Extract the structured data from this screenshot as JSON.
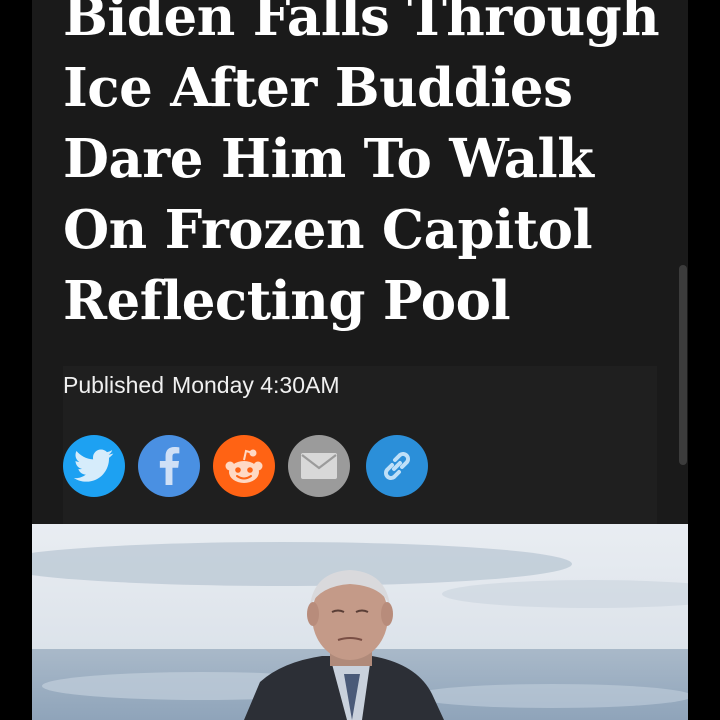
{
  "article": {
    "headline_lines": [
      "Biden Falls Through",
      "Ice After Buddies",
      "Dare Him To Walk",
      "On Frozen Capitol",
      "Reflecting Pool"
    ],
    "published_label": "Published",
    "published_time": "Monday 4:30AM"
  },
  "share_buttons": [
    {
      "name": "twitter",
      "icon": "twitter-bird-icon",
      "color": "#1da1f2"
    },
    {
      "name": "facebook",
      "icon": "facebook-f-icon",
      "color": "#4a90e2"
    },
    {
      "name": "reddit",
      "icon": "reddit-alien-icon",
      "color": "#ff6314"
    },
    {
      "name": "email",
      "icon": "envelope-icon",
      "color": "#9b9b9b"
    },
    {
      "name": "link",
      "icon": "chain-link-icon",
      "color": "#2b8fd9"
    }
  ],
  "colors": {
    "page_background": "#000000",
    "article_background": "#1a1a1a",
    "headline_text": "#ffffff"
  }
}
